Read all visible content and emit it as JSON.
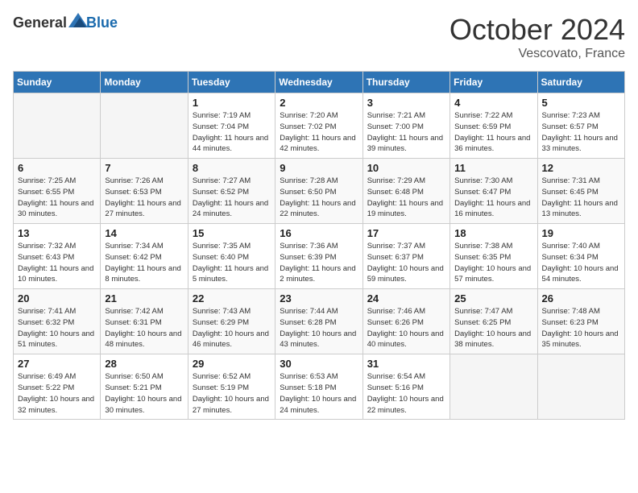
{
  "header": {
    "logo_general": "General",
    "logo_blue": "Blue",
    "month": "October 2024",
    "location": "Vescovato, France"
  },
  "weekdays": [
    "Sunday",
    "Monday",
    "Tuesday",
    "Wednesday",
    "Thursday",
    "Friday",
    "Saturday"
  ],
  "weeks": [
    [
      {
        "day": "",
        "empty": true
      },
      {
        "day": "",
        "empty": true
      },
      {
        "day": "1",
        "sunrise": "7:19 AM",
        "sunset": "7:04 PM",
        "daylight": "11 hours and 44 minutes."
      },
      {
        "day": "2",
        "sunrise": "7:20 AM",
        "sunset": "7:02 PM",
        "daylight": "11 hours and 42 minutes."
      },
      {
        "day": "3",
        "sunrise": "7:21 AM",
        "sunset": "7:00 PM",
        "daylight": "11 hours and 39 minutes."
      },
      {
        "day": "4",
        "sunrise": "7:22 AM",
        "sunset": "6:59 PM",
        "daylight": "11 hours and 36 minutes."
      },
      {
        "day": "5",
        "sunrise": "7:23 AM",
        "sunset": "6:57 PM",
        "daylight": "11 hours and 33 minutes."
      }
    ],
    [
      {
        "day": "6",
        "sunrise": "7:25 AM",
        "sunset": "6:55 PM",
        "daylight": "11 hours and 30 minutes."
      },
      {
        "day": "7",
        "sunrise": "7:26 AM",
        "sunset": "6:53 PM",
        "daylight": "11 hours and 27 minutes."
      },
      {
        "day": "8",
        "sunrise": "7:27 AM",
        "sunset": "6:52 PM",
        "daylight": "11 hours and 24 minutes."
      },
      {
        "day": "9",
        "sunrise": "7:28 AM",
        "sunset": "6:50 PM",
        "daylight": "11 hours and 22 minutes."
      },
      {
        "day": "10",
        "sunrise": "7:29 AM",
        "sunset": "6:48 PM",
        "daylight": "11 hours and 19 minutes."
      },
      {
        "day": "11",
        "sunrise": "7:30 AM",
        "sunset": "6:47 PM",
        "daylight": "11 hours and 16 minutes."
      },
      {
        "day": "12",
        "sunrise": "7:31 AM",
        "sunset": "6:45 PM",
        "daylight": "11 hours and 13 minutes."
      }
    ],
    [
      {
        "day": "13",
        "sunrise": "7:32 AM",
        "sunset": "6:43 PM",
        "daylight": "11 hours and 10 minutes."
      },
      {
        "day": "14",
        "sunrise": "7:34 AM",
        "sunset": "6:42 PM",
        "daylight": "11 hours and 8 minutes."
      },
      {
        "day": "15",
        "sunrise": "7:35 AM",
        "sunset": "6:40 PM",
        "daylight": "11 hours and 5 minutes."
      },
      {
        "day": "16",
        "sunrise": "7:36 AM",
        "sunset": "6:39 PM",
        "daylight": "11 hours and 2 minutes."
      },
      {
        "day": "17",
        "sunrise": "7:37 AM",
        "sunset": "6:37 PM",
        "daylight": "10 hours and 59 minutes."
      },
      {
        "day": "18",
        "sunrise": "7:38 AM",
        "sunset": "6:35 PM",
        "daylight": "10 hours and 57 minutes."
      },
      {
        "day": "19",
        "sunrise": "7:40 AM",
        "sunset": "6:34 PM",
        "daylight": "10 hours and 54 minutes."
      }
    ],
    [
      {
        "day": "20",
        "sunrise": "7:41 AM",
        "sunset": "6:32 PM",
        "daylight": "10 hours and 51 minutes."
      },
      {
        "day": "21",
        "sunrise": "7:42 AM",
        "sunset": "6:31 PM",
        "daylight": "10 hours and 48 minutes."
      },
      {
        "day": "22",
        "sunrise": "7:43 AM",
        "sunset": "6:29 PM",
        "daylight": "10 hours and 46 minutes."
      },
      {
        "day": "23",
        "sunrise": "7:44 AM",
        "sunset": "6:28 PM",
        "daylight": "10 hours and 43 minutes."
      },
      {
        "day": "24",
        "sunrise": "7:46 AM",
        "sunset": "6:26 PM",
        "daylight": "10 hours and 40 minutes."
      },
      {
        "day": "25",
        "sunrise": "7:47 AM",
        "sunset": "6:25 PM",
        "daylight": "10 hours and 38 minutes."
      },
      {
        "day": "26",
        "sunrise": "7:48 AM",
        "sunset": "6:23 PM",
        "daylight": "10 hours and 35 minutes."
      }
    ],
    [
      {
        "day": "27",
        "sunrise": "6:49 AM",
        "sunset": "5:22 PM",
        "daylight": "10 hours and 32 minutes."
      },
      {
        "day": "28",
        "sunrise": "6:50 AM",
        "sunset": "5:21 PM",
        "daylight": "10 hours and 30 minutes."
      },
      {
        "day": "29",
        "sunrise": "6:52 AM",
        "sunset": "5:19 PM",
        "daylight": "10 hours and 27 minutes."
      },
      {
        "day": "30",
        "sunrise": "6:53 AM",
        "sunset": "5:18 PM",
        "daylight": "10 hours and 24 minutes."
      },
      {
        "day": "31",
        "sunrise": "6:54 AM",
        "sunset": "5:16 PM",
        "daylight": "10 hours and 22 minutes."
      },
      {
        "day": "",
        "empty": true
      },
      {
        "day": "",
        "empty": true
      }
    ]
  ]
}
